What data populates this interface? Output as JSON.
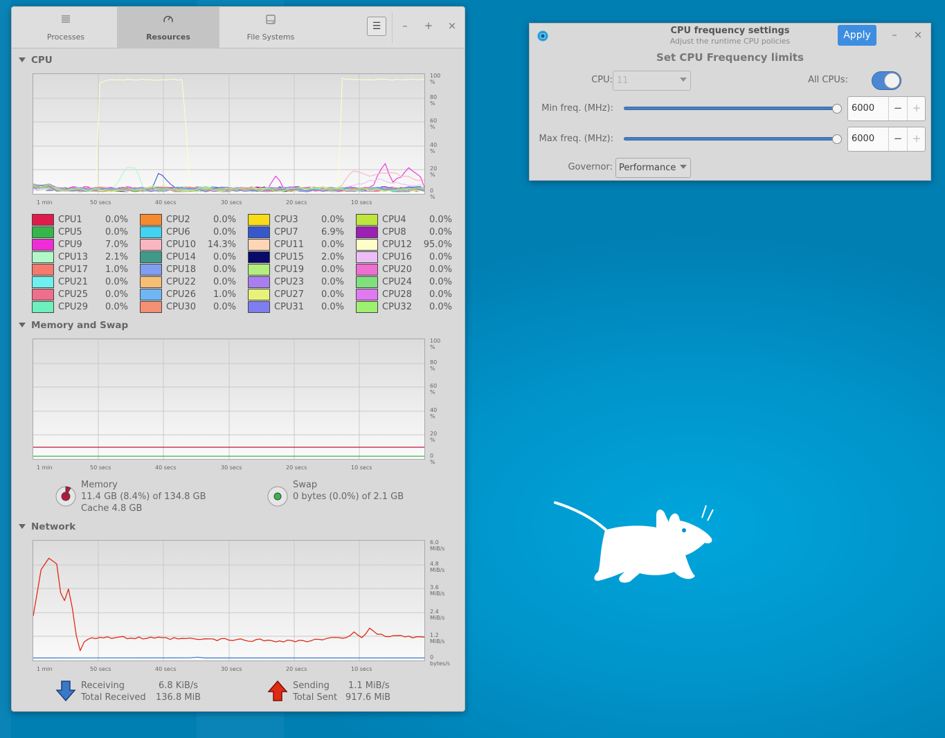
{
  "monitor": {
    "tabs": [
      {
        "label": "Processes",
        "icon": "processes-icon"
      },
      {
        "label": "Resources",
        "icon": "speedometer-icon"
      },
      {
        "label": "File Systems",
        "icon": "disk-icon"
      }
    ],
    "menu_glyph": "☰",
    "minimize_glyph": "–",
    "maximize_glyph": "+",
    "close_glyph": "×",
    "sections": {
      "cpu": "CPU",
      "memory": "Memory and Swap",
      "network": "Network"
    },
    "percent_ticks": [
      "100 %",
      "80 %",
      "60 %",
      "40 %",
      "20 %",
      "0 %"
    ],
    "network_ticks": [
      "6.0 MiB/s",
      "4.8 MiB/s",
      "3.6 MiB/s",
      "2.4 MiB/s",
      "1.2 MiB/s",
      "0 bytes/s"
    ],
    "time_ticks": [
      "1 min",
      "50 secs",
      "40 secs",
      "30 secs",
      "20 secs",
      "10 secs"
    ],
    "cpus": [
      {
        "name": "CPU1",
        "value": "0.0%",
        "color": "#e01b4c"
      },
      {
        "name": "CPU2",
        "value": "0.0%",
        "color": "#f68a2e"
      },
      {
        "name": "CPU3",
        "value": "0.0%",
        "color": "#f9dc18"
      },
      {
        "name": "CPU4",
        "value": "0.0%",
        "color": "#bfe63d"
      },
      {
        "name": "CPU5",
        "value": "0.0%",
        "color": "#35b54a"
      },
      {
        "name": "CPU6",
        "value": "0.0%",
        "color": "#44d2f2"
      },
      {
        "name": "CPU7",
        "value": "6.9%",
        "color": "#3558cd"
      },
      {
        "name": "CPU8",
        "value": "0.0%",
        "color": "#9d1fb3"
      },
      {
        "name": "CPU9",
        "value": "7.0%",
        "color": "#ee2dd8"
      },
      {
        "name": "CPU10",
        "value": "14.3%",
        "color": "#f7b6c0"
      },
      {
        "name": "CPU11",
        "value": "0.0%",
        "color": "#fdd6b8"
      },
      {
        "name": "CPU12",
        "value": "95.0%",
        "color": "#fefecb"
      },
      {
        "name": "CPU13",
        "value": "2.1%",
        "color": "#b1f7c8"
      },
      {
        "name": "CPU14",
        "value": "0.0%",
        "color": "#3f9a8a"
      },
      {
        "name": "CPU15",
        "value": "2.0%",
        "color": "#0a0a6a"
      },
      {
        "name": "CPU16",
        "value": "0.0%",
        "color": "#ecbef6"
      },
      {
        "name": "CPU17",
        "value": "1.0%",
        "color": "#f57a6e"
      },
      {
        "name": "CPU18",
        "value": "0.0%",
        "color": "#7f9ef2"
      },
      {
        "name": "CPU19",
        "value": "0.0%",
        "color": "#b4ee7c"
      },
      {
        "name": "CPU20",
        "value": "0.0%",
        "color": "#ef6ed2"
      },
      {
        "name": "CPU21",
        "value": "0.0%",
        "color": "#6ef0ee"
      },
      {
        "name": "CPU22",
        "value": "0.0%",
        "color": "#f7be76"
      },
      {
        "name": "CPU23",
        "value": "0.0%",
        "color": "#a97ef0"
      },
      {
        "name": "CPU24",
        "value": "0.0%",
        "color": "#7ee27c"
      },
      {
        "name": "CPU25",
        "value": "0.0%",
        "color": "#ee6e8c"
      },
      {
        "name": "CPU26",
        "value": "1.0%",
        "color": "#70b6f4"
      },
      {
        "name": "CPU27",
        "value": "0.0%",
        "color": "#e6f27a"
      },
      {
        "name": "CPU28",
        "value": "0.0%",
        "color": "#e07af0"
      },
      {
        "name": "CPU29",
        "value": "0.0%",
        "color": "#6ef0be"
      },
      {
        "name": "CPU30",
        "value": "0.0%",
        "color": "#f49074"
      },
      {
        "name": "CPU31",
        "value": "0.0%",
        "color": "#7e7ef0"
      },
      {
        "name": "CPU32",
        "value": "0.0%",
        "color": "#9ef070"
      }
    ],
    "memory": {
      "label": "Memory",
      "used": "11.4 GB (8.4%) of 134.8 GB",
      "cache": "Cache 4.8 GB",
      "fraction": 0.084,
      "color": "#c0143c"
    },
    "swap": {
      "label": "Swap",
      "used": "0 bytes (0.0%) of 2.1 GB",
      "fraction": 0.0,
      "color": "#35b54a"
    },
    "network": {
      "receiving_label": "Receiving",
      "receiving_value": "6.8 KiB/s",
      "total_received_label": "Total Received",
      "total_received_value": "136.8 MiB",
      "sending_label": "Sending",
      "sending_value": "1.1 MiB/s",
      "total_sent_label": "Total Sent",
      "total_sent_value": "917.6 MiB",
      "receive_color": "#3a78c8",
      "send_color": "#e02a14"
    }
  },
  "freq": {
    "title": "CPU frequency settings",
    "subtitle": "Adjust the runtime CPU policies",
    "apply_label": "Apply",
    "minimize_glyph": "–",
    "close_glyph": "×",
    "heading": "Set CPU Frequency limits",
    "cpu_label": "CPU:",
    "cpu_value": "11",
    "all_cpus_label": "All CPUs:",
    "all_cpus_on": true,
    "min_label": "Min freq. (MHz):",
    "min_value": "6000",
    "max_label": "Max freq. (MHz):",
    "max_value": "6000",
    "slider_level": 1.0,
    "minus_glyph": "−",
    "plus_glyph": "+",
    "governor_label": "Governor:",
    "governor_value": "Performance",
    "accent": "#3d8ee0"
  }
}
